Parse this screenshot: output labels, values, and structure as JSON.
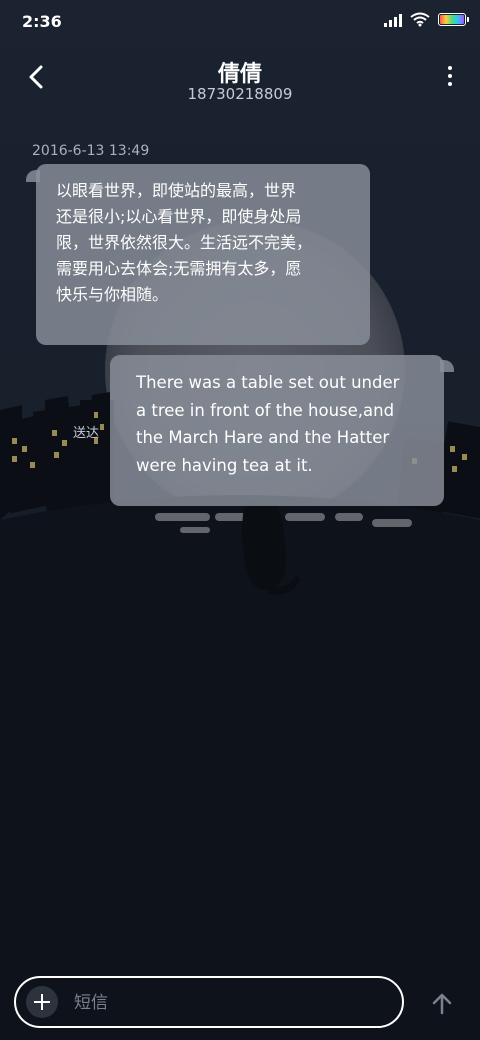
{
  "status_bar": {
    "time": "2:36"
  },
  "header": {
    "contact_name": "倩倩",
    "phone_number": "18730218809"
  },
  "conversation": {
    "timestamp": "2016-6-13 13:49",
    "incoming_lines": [
      "以眼看世界，即使站的最高，世界",
      "还是很小;以心看世界，即使身处局",
      "限，世界依然很大。生活远不完美，",
      "需要用心去体会;无需拥有太多，愿",
      "快乐与你相随。"
    ],
    "outgoing_lines": [
      "There was a table set out under",
      "a tree in front of the house,and",
      "the March Hare and the Hatter",
      "were having tea at it."
    ],
    "delivered_label": "送达"
  },
  "composer": {
    "placeholder": "短信"
  },
  "colors": {
    "bubble": "#8a909b",
    "background_top": "#1b2230",
    "background_bottom": "#0c1119",
    "moon": "#53565e"
  }
}
